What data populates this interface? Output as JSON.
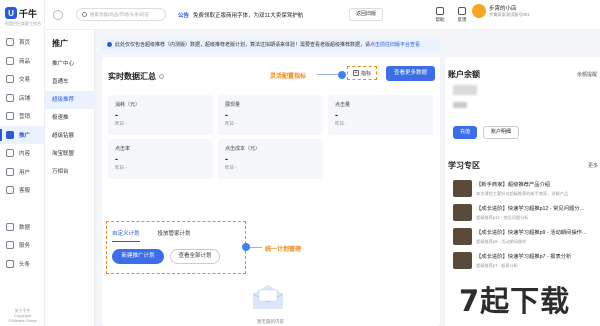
{
  "app": {
    "logo_mark": "U",
    "logo_text": "千牛",
    "logo_sub": "阿里巴巴卖家工作台",
    "footer_lines": [
      "关于千牛",
      "Copyright",
      "©Alibaba Group"
    ]
  },
  "primary_nav": [
    {
      "label": "首页",
      "icon": "home-icon"
    },
    {
      "label": "商品",
      "icon": "goods-icon"
    },
    {
      "label": "交易",
      "icon": "trade-icon"
    },
    {
      "label": "店铺",
      "icon": "shop-icon"
    },
    {
      "label": "营销",
      "icon": "marketing-icon"
    },
    {
      "label": "推广",
      "icon": "promotion-icon",
      "active": true
    },
    {
      "label": "内容",
      "icon": "content-icon"
    },
    {
      "label": "用户",
      "icon": "user-icon"
    },
    {
      "label": "客服",
      "icon": "service-icon"
    },
    {
      "label": "数据",
      "icon": "data-icon"
    },
    {
      "label": "服务",
      "icon": "apps-icon"
    },
    {
      "label": "头条",
      "icon": "news-icon"
    }
  ],
  "secondary_nav": {
    "title": "推广",
    "items": [
      {
        "label": "推广中心"
      },
      {
        "label": "直通车"
      },
      {
        "label": "超级推荐",
        "active": true
      },
      {
        "label": "极速推"
      },
      {
        "label": "超级钻展"
      },
      {
        "label": "淘宝联盟"
      },
      {
        "label": "万相台"
      }
    ]
  },
  "topbar": {
    "search_placeholder": "搜索功能/商品/市场/头条/问答",
    "notice_label": "公告",
    "notice_text": "免费领取正版商用字体，为双11大卖保驾护航",
    "back_label": "返回旧版",
    "tools": [
      {
        "label": "帮助",
        "icon": "help-icon"
      },
      {
        "label": "反馈",
        "icon": "feedback-icon"
      }
    ],
    "shop_name": "步霄的小店",
    "shop_sub": "步霄家家测试账号001"
  },
  "tip": {
    "text": "此处仅仅包含超级推荐（内测版）数据，超级推荐老版计划，算法过拟期请来体验！需要查看老版超级推荐数据，请",
    "link": "点击前往旧版平台查看"
  },
  "realtime": {
    "title": "实时数据汇总",
    "annotation": "灵活配置指标",
    "metric_button": "指标",
    "view_more": "查看更多数据",
    "stats": [
      {
        "label": "消耗（元）",
        "value": "-",
        "compare": "昨日 -"
      },
      {
        "label": "展现量",
        "value": "-",
        "compare": "昨日 -"
      },
      {
        "label": "点击量",
        "value": "-",
        "compare": "昨日 -"
      },
      {
        "label": "点击率",
        "value": "-",
        "compare": "昨日 -"
      },
      {
        "label": "点击成本（元）",
        "value": "-",
        "compare": "昨日 -"
      }
    ]
  },
  "plan": {
    "tabs": [
      {
        "label": "自定义计划",
        "active": true
      },
      {
        "label": "投放管家计划"
      }
    ],
    "new_button": "新建推广计划",
    "view_all_button": "查看全部计划",
    "annotation": "统一计划管理",
    "empty_text": "暂无最新内容"
  },
  "account": {
    "title": "账户余额",
    "link": "余额提醒",
    "recharge": "充值",
    "detail": "账户明细"
  },
  "study": {
    "title": "学习专区",
    "more": "更多",
    "items": [
      {
        "title": "【新手商家】超级推荐产品介绍",
        "desc": "本次课程主要针对超级推荐的新手商家，讲解产品"
      },
      {
        "title": "【成长进阶】快速学习超推p12 - 常见问题分...",
        "desc": "超级推荐p12 - 常见问题分析"
      },
      {
        "title": "【成长进阶】快速学习超推p9 - 活动期间操作...",
        "desc": "超级推荐p9 - 活动期间操作"
      },
      {
        "title": "【成长进阶】快速学习超推p7 - 报表分析",
        "desc": "超级推荐p7 - 报表分析"
      }
    ]
  },
  "watermark": "7起下载",
  "colors": {
    "accent": "#3c6ee8",
    "annotation": "#f08a17",
    "active_bg": "#eaf1ff"
  }
}
